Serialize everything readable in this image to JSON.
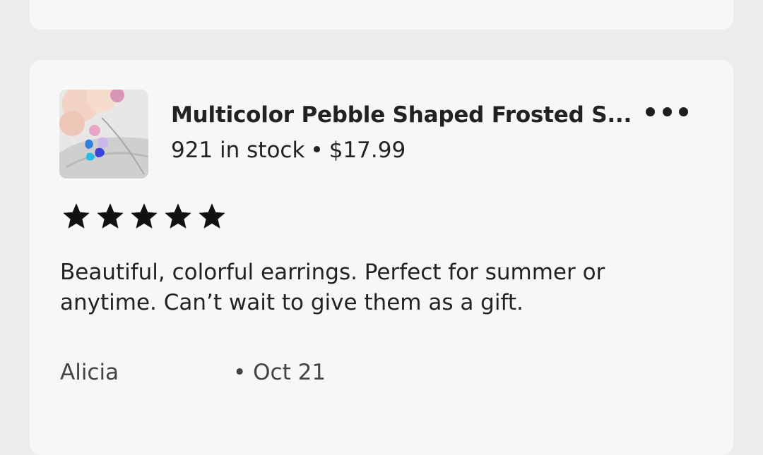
{
  "product": {
    "title": "Multicolor Pebble Shaped Frosted S...",
    "stock": "921 in stock",
    "separator": "•",
    "price": "$17.99",
    "thumbnail_icon": "earrings-photo"
  },
  "menu": {
    "icon": "more-horizontal-icon"
  },
  "review": {
    "rating": 5,
    "rating_max": 5,
    "text": "Beautiful, colorful earrings. Perfect for summer or anytime. Can’t wait to give them as a gift.",
    "reviewer": "Alicia",
    "date": "• Oct 21"
  },
  "colors": {
    "background": "#ececec",
    "card": "#f7f7f7",
    "text": "#222222",
    "star": "#111111"
  }
}
